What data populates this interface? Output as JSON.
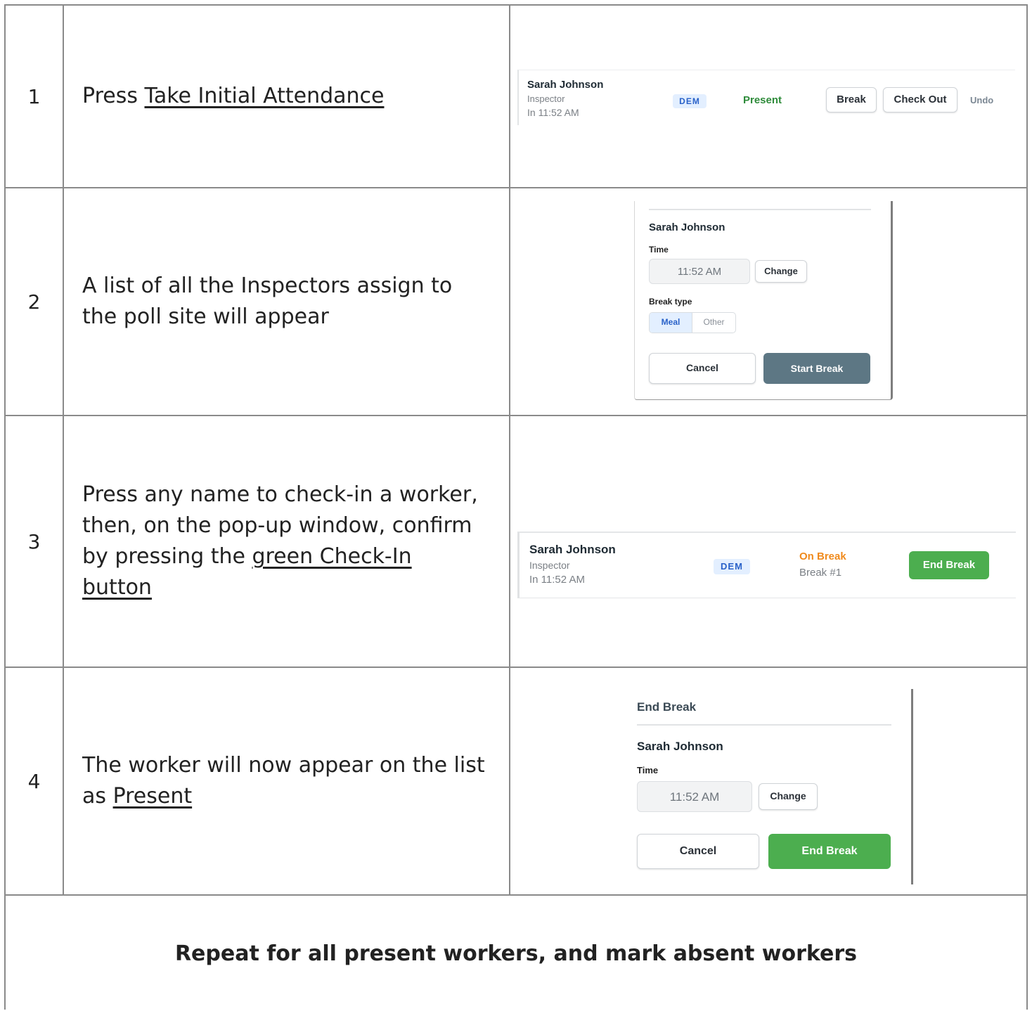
{
  "rows": [
    {
      "number": "1",
      "text_before": "Press ",
      "text_link": "Take Initial Attendance",
      "ui": {
        "name": "Sarah Johnson",
        "role": "Inspector",
        "time_in": "In 11:52 AM",
        "badge": "DEM",
        "status": "Present",
        "break_label": "Break",
        "checkout_label": "Check Out",
        "undo_label": "Undo"
      }
    },
    {
      "number": "2",
      "text_line1": "A list of all the Inspectors assign to",
      "text_line2": "the poll site will appear",
      "ui": {
        "name": "Sarah Johnson",
        "time_label": "Time",
        "time_value": "11:52 AM",
        "change_label": "Change",
        "break_type_label": "Break type",
        "options": [
          "Meal",
          "Other"
        ],
        "selected_option": "Meal",
        "cancel_label": "Cancel",
        "start_label": "Start Break"
      }
    },
    {
      "number": "3",
      "text_line1": "Press any name to check-in a worker,",
      "text_line2": "then, on the pop-up window, confirm",
      "text_line3_before": "by pressing the ",
      "text_line3_link": "green Check-In",
      "text_line4_link": "button",
      "ui": {
        "name": "Sarah Johnson",
        "role": "Inspector",
        "time_in": "In 11:52 AM",
        "badge": "DEM",
        "status": "On Break",
        "break_count": "Break #1",
        "end_break_label": "End Break"
      }
    },
    {
      "number": "4",
      "text_line1": "The worker will now appear on the list",
      "text_line2_before": "as ",
      "text_line2_link": "Present",
      "ui": {
        "title": "End Break",
        "name": "Sarah Johnson",
        "time_label": "Time",
        "time_value": "11:52 AM",
        "change_label": "Change",
        "cancel_label": "Cancel",
        "end_label": "End Break"
      }
    }
  ],
  "footer": "Repeat for all present workers, and mark absent workers",
  "colors": {
    "present_green": "#2e8b3a",
    "on_break_orange": "#f08a1c",
    "end_break_green": "#4cae4f",
    "start_break_slate": "#5d7784",
    "badge_blue": "#2a62c9"
  }
}
